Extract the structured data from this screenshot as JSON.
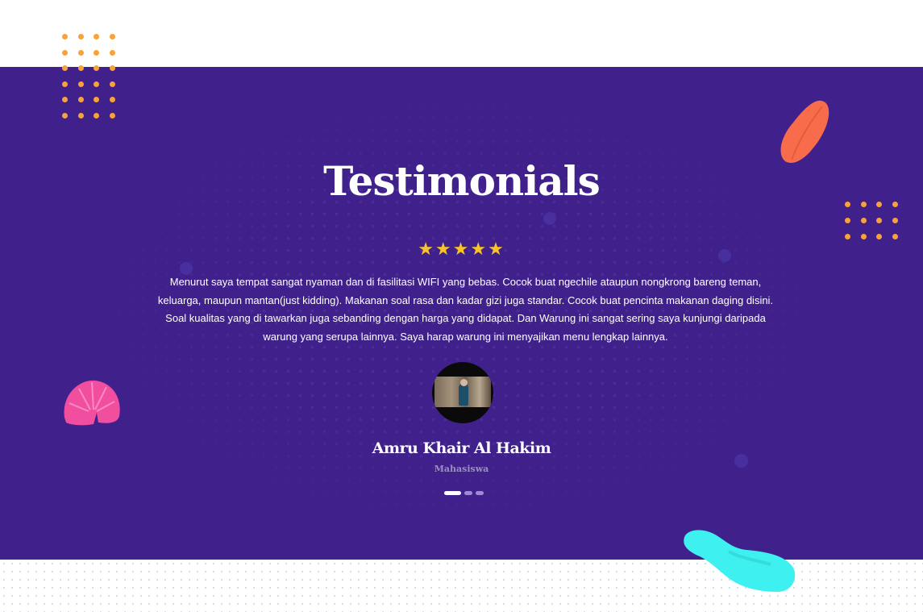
{
  "section": {
    "title": "Testimonials",
    "stars": "★★★★★",
    "rating": 5,
    "quote": "Menurut saya tempat sangat nyaman dan di fasilitasi WIFI yang bebas. Cocok buat ngechile ataupun nongkrong bareng teman, keluarga, maupun mantan(just kidding). Makanan soal rasa dan kadar gizi juga standar. Cocok buat pencinta makanan daging disini. Soal kualitas yang di tawarkan juga sebanding dengan harga yang didapat. Dan Warung ini sangat sering saya kunjungi daripada warung yang serupa lainnya. Saya harap warung ini menyajikan menu lengkap lainnya.",
    "author_name": "Amru Khair Al Hakim",
    "author_role": "Mahasiswa",
    "slides_total": 3,
    "active_slide": 1
  },
  "colors": {
    "band": "#40218c",
    "star": "#f8c32b",
    "orange_dots": "#f7a23b",
    "leaf": "#f86c4b",
    "pink": "#f24ea0",
    "cyan": "#3ef0f0"
  },
  "icons": [
    "star-icon",
    "leaf-shape",
    "pink-shell-shape",
    "cyan-blob-shape",
    "dot-grid-pattern"
  ]
}
